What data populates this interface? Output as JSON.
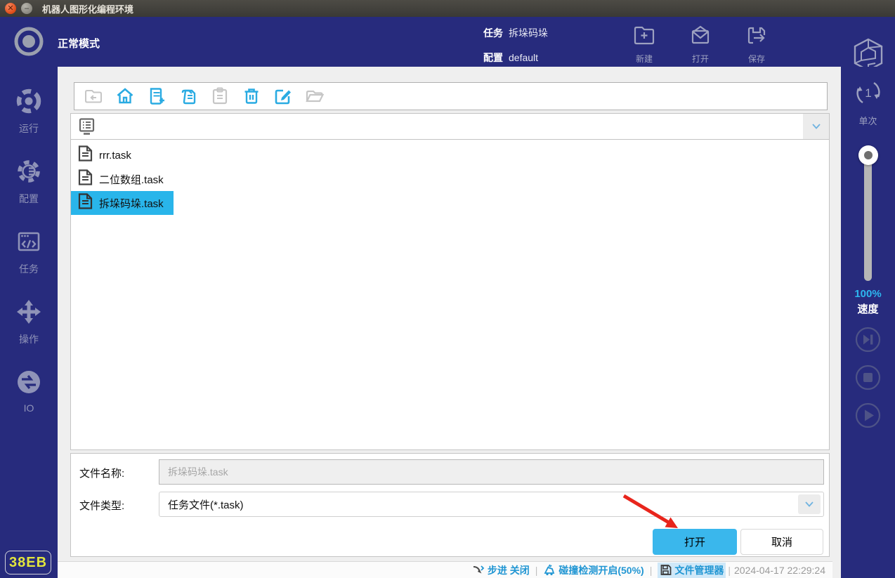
{
  "window": {
    "title": "机器人图形化编程环境"
  },
  "header": {
    "mode_label": "正常模式",
    "task_label": "任务",
    "task_value": "拆垛码垛",
    "config_label": "配置",
    "config_value": "default",
    "actions": {
      "new": "新建",
      "open": "打开",
      "save": "保存"
    }
  },
  "sidebar": {
    "items": [
      {
        "label": "运行"
      },
      {
        "label": "配置"
      },
      {
        "label": "任务"
      },
      {
        "label": "操作"
      },
      {
        "label": "IO"
      }
    ],
    "badge": "38EB"
  },
  "right_panel": {
    "single_label": "单次",
    "speed_percent": "100%",
    "speed_label": "速度"
  },
  "file_dialog": {
    "files": [
      {
        "name": "rrr.task",
        "selected": false
      },
      {
        "name": "二位数组.task",
        "selected": false
      },
      {
        "name": "拆垛码垛.task",
        "selected": true
      }
    ],
    "file_name_label": "文件名称:",
    "file_name_value": "拆垛码垛.task",
    "file_type_label": "文件类型:",
    "file_type_value": "任务文件(*.task)",
    "open_button": "打开",
    "cancel_button": "取消"
  },
  "status_bar": {
    "step": "步进 关闭",
    "collision": "碰撞检测开启(50%)",
    "file_manager": "文件管理器",
    "timestamp": "2024-04-17 22:29:24"
  },
  "colors": {
    "navy": "#272b7d",
    "accent_blue": "#29aae1",
    "selection_blue": "#29b5ea",
    "open_button_blue": "#3ab7ec",
    "status_text_blue": "#2196d3",
    "badge_yellow": "#e2e53d"
  }
}
